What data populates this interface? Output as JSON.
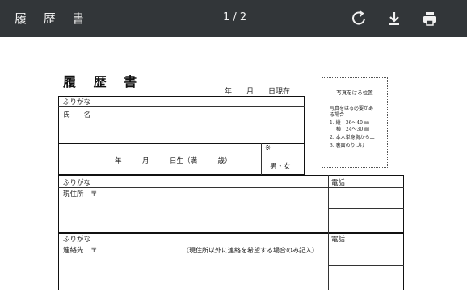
{
  "toolbar": {
    "title": "履 歴 書",
    "page_indicator": "1 / 2",
    "icons": [
      "rotate-icon",
      "download-icon",
      "print-icon"
    ],
    "background": "#323639"
  },
  "document": {
    "title": "履 歴 書",
    "date_line": "年　　月　　日現在",
    "photo": {
      "title": "写真をはる位置",
      "lines": [
        "写真をはる必要があ",
        "る場合",
        "1. 縦　36〜40 ㎜",
        "　 横　24〜30 ㎜",
        "2. 本人単身胸から上",
        "3. 裏面のりづけ"
      ]
    },
    "section1": {
      "furigana": "ふりがな",
      "name_label": "氏　　名",
      "birth_line": "年　　　月　　　日生（満　　　歳）",
      "note_mark": "※",
      "gender": "男・女"
    },
    "section2": {
      "furigana": "ふりがな",
      "address_label": "現住所　〒",
      "phone_label": "電話"
    },
    "section3": {
      "furigana": "ふりがな",
      "contact_label": "連絡先　〒",
      "contact_note": "（現住所以外に連絡を希望する場合のみ記入）",
      "phone_label": "電話"
    }
  }
}
